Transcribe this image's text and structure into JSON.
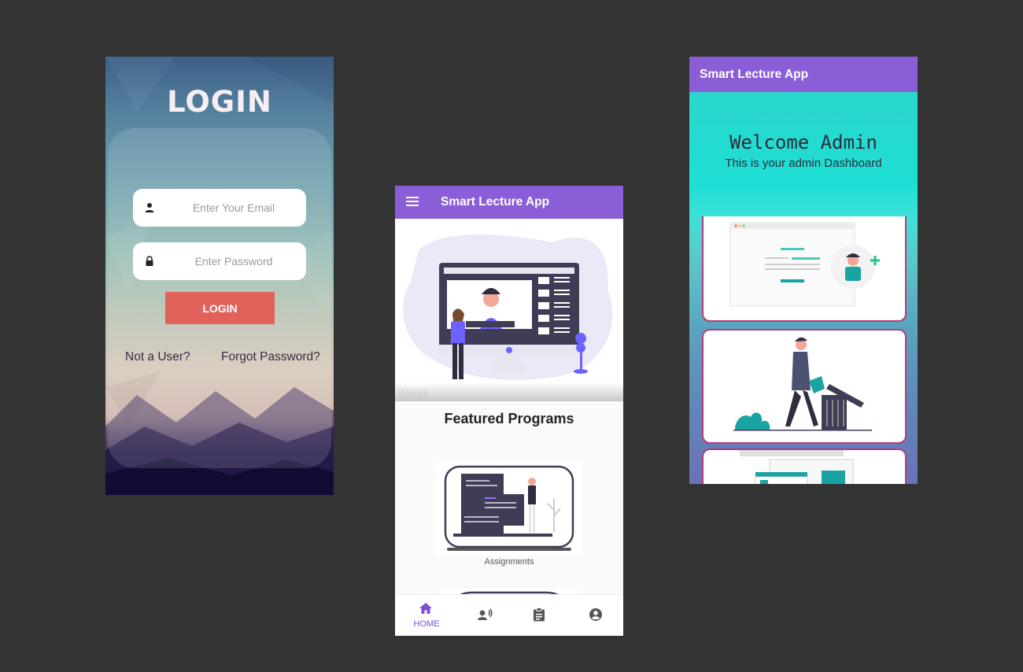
{
  "login": {
    "title": "LOGIN",
    "email_placeholder": "Enter Your Email",
    "password_placeholder": "Enter Password",
    "button_label": "LOGIN",
    "not_user_link": "Not a User?",
    "forgot_link": "Forgot Password?",
    "icons": {
      "email": "person-icon",
      "password": "lock-icon"
    },
    "colors": {
      "button": "#e0625b",
      "text": "#3a2d44"
    }
  },
  "home": {
    "app_title": "Smart Lecture App",
    "slider_caption": "Tutorial",
    "slider_dot_count": 7,
    "slider_active_dot": 3,
    "section_title": "Featured Programs",
    "card_label": "Assignments",
    "bottom_nav": [
      {
        "label": "HOME",
        "icon": "home-icon",
        "active": true
      },
      {
        "label": "",
        "icon": "record-voice-icon",
        "active": false
      },
      {
        "label": "",
        "icon": "clipboard-icon",
        "active": false
      },
      {
        "label": "",
        "icon": "account-circle-icon",
        "active": false
      }
    ],
    "colors": {
      "appbar": "#8a5ed6",
      "accent": "#7b4fd3"
    }
  },
  "admin": {
    "app_title": "Smart Lecture App",
    "welcome_title": "Welcome Admin",
    "subtitle": "This is your admin Dashboard",
    "colors": {
      "appbar": "#8a5ed6",
      "card_border": "#b43a7d",
      "teal": "#1edfd6"
    }
  }
}
